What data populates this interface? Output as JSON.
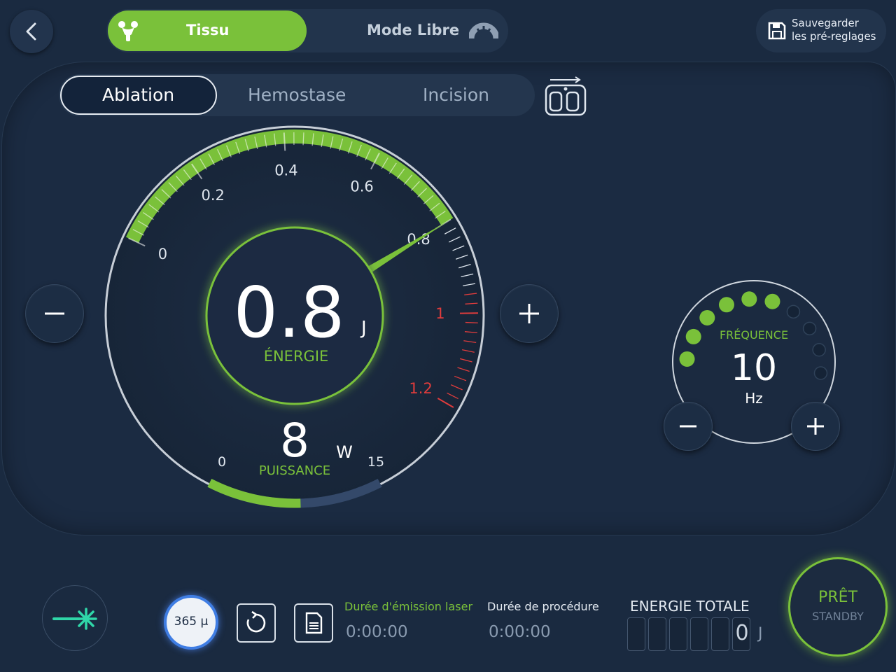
{
  "header": {
    "tabs": [
      {
        "label": "Tissu",
        "icon": "tissue-icon",
        "active": true
      },
      {
        "label": "Mode Libre",
        "icon": "speedometer-icon",
        "active": false
      }
    ],
    "save_line1": "Sauvegarder",
    "save_line2": "les pré-reglages"
  },
  "mode_tabs": [
    {
      "label": "Ablation",
      "active": true
    },
    {
      "label": "Hemostase",
      "active": false
    },
    {
      "label": "Incision",
      "active": false
    }
  ],
  "energy_gauge": {
    "value": "0.8",
    "unit": "J",
    "label": "ÉNERGIE",
    "scale_labels": [
      "0",
      "0.2",
      "0.4",
      "0.6",
      "0.8",
      "1",
      "1.2"
    ],
    "current": 0.8,
    "min": 0,
    "max": 1.2
  },
  "power": {
    "value": "8",
    "unit": "W",
    "label": "PUISSANCE",
    "min_label": "0",
    "max_label": "15",
    "current": 8,
    "max": 15
  },
  "frequency": {
    "label": "FRÉQUENCE",
    "value": "10",
    "unit": "Hz",
    "dots_active": 6,
    "dots_total": 10
  },
  "bottom": {
    "fiber_label": "365 µ",
    "laser_time_label": "Durée d'émission laser",
    "laser_time_value": "0:00:00",
    "procedure_time_label": "Durée de procédure",
    "procedure_time_value": "0:00:00",
    "total_energy_label": "ENERGIE TOTALE",
    "total_energy_value": "0",
    "total_energy_unit": "J"
  },
  "ready_button": {
    "line1": "PRÊT",
    "line2": "STANDBY"
  },
  "colors": {
    "accent": "#7ac13a",
    "danger": "#e03c3c",
    "background": "#1a2a40"
  }
}
